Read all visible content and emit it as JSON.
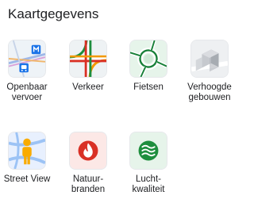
{
  "title": "Kaartgegevens",
  "tiles": [
    {
      "label": "Openbaar\nvervoer",
      "icon": "public-transport-icon"
    },
    {
      "label": "Verkeer",
      "icon": "traffic-icon"
    },
    {
      "label": "Fietsen",
      "icon": "cycling-icon"
    },
    {
      "label": "Verhoogde\ngebouwen",
      "icon": "3d-buildings-icon"
    },
    {
      "label": "Street View",
      "icon": "street-view-icon"
    },
    {
      "label": "Natuur-\nbranden",
      "icon": "wildfire-icon"
    },
    {
      "label": "Lucht-\nkwaliteit",
      "icon": "air-quality-icon"
    }
  ],
  "colors": {
    "transit_blue": "#1a73e8",
    "traffic_red": "#d93025",
    "traffic_green": "#1e8e3e",
    "cycling_green": "#188038",
    "pegman_yellow": "#f9ab00",
    "wildfire_red": "#d93025",
    "air_quality_green": "#1e8e3e"
  }
}
